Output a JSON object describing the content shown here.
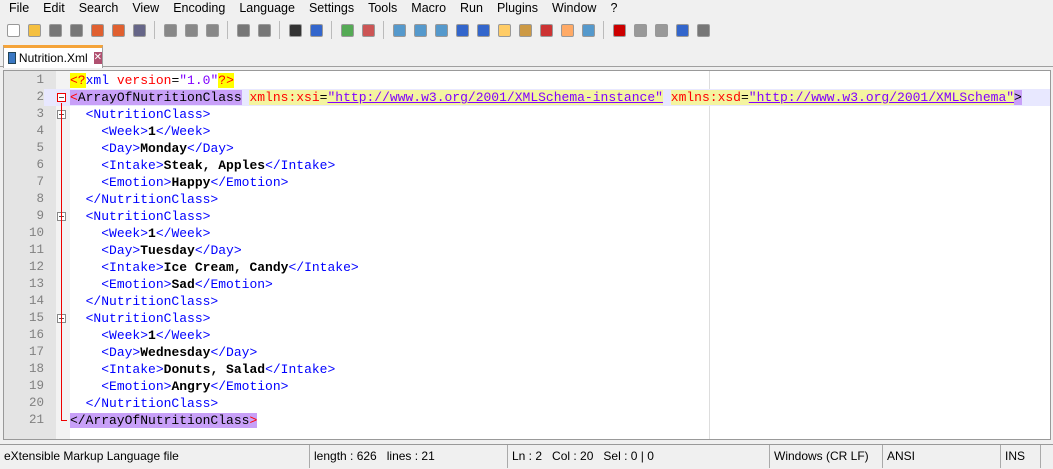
{
  "menu": [
    "File",
    "Edit",
    "Search",
    "View",
    "Encoding",
    "Language",
    "Settings",
    "Tools",
    "Macro",
    "Run",
    "Plugins",
    "Window",
    "?"
  ],
  "toolbar": [
    "new",
    "open",
    "save",
    "save-all",
    "close",
    "close-all",
    "print",
    "|",
    "cut",
    "copy",
    "paste",
    "|",
    "undo",
    "redo",
    "|",
    "find",
    "replace",
    "|",
    "zoom-in",
    "zoom-out",
    "|",
    "sync-v",
    "sync-h",
    "wrap",
    "all-chars",
    "indent-guide",
    "udl",
    "doc-map",
    "function-list",
    "folder",
    "monitor",
    "|",
    "record",
    "stop",
    "play",
    "play-multiple",
    "save-macro"
  ],
  "tab": {
    "label": "Nutrition.Xml",
    "close": "✕"
  },
  "current_line": 2,
  "lines": [
    [
      [
        "pi",
        "<?"
      ],
      [
        "piname",
        "xml "
      ],
      [
        "attr",
        "version"
      ],
      [
        "eq",
        "="
      ],
      [
        "val",
        "\"1.0\""
      ],
      [
        "pi",
        "?>"
      ]
    ],
    [
      [
        "hlbr",
        "<"
      ],
      [
        "hl",
        "ArrayOfNutritionClass"
      ],
      [
        "txt",
        " "
      ],
      [
        "hlattr",
        "xmlns:xsi"
      ],
      [
        "hleq",
        "="
      ],
      [
        "hlval",
        "\"http://www.w3.org/2001/XMLSchema-instance\""
      ],
      [
        "txt",
        " "
      ],
      [
        "hlattr",
        "xmlns:xsd"
      ],
      [
        "hleq",
        "="
      ],
      [
        "hlval",
        "\"http://www.w3.org/2001/XMLSchema\""
      ],
      [
        "hl",
        ">"
      ]
    ],
    [
      [
        "txt",
        "  "
      ],
      [
        "tag",
        "<NutritionClass>"
      ]
    ],
    [
      [
        "txt",
        "    "
      ],
      [
        "tag",
        "<Week>"
      ],
      [
        "txt",
        "1"
      ],
      [
        "tag",
        "</Week>"
      ]
    ],
    [
      [
        "txt",
        "    "
      ],
      [
        "tag",
        "<Day>"
      ],
      [
        "txt",
        "Monday"
      ],
      [
        "tag",
        "</Day>"
      ]
    ],
    [
      [
        "txt",
        "    "
      ],
      [
        "tag",
        "<Intake>"
      ],
      [
        "txt",
        "Steak, Apples"
      ],
      [
        "tag",
        "</Intake>"
      ]
    ],
    [
      [
        "txt",
        "    "
      ],
      [
        "tag",
        "<Emotion>"
      ],
      [
        "txt",
        "Happy"
      ],
      [
        "tag",
        "</Emotion>"
      ]
    ],
    [
      [
        "txt",
        "  "
      ],
      [
        "tag",
        "</NutritionClass>"
      ]
    ],
    [
      [
        "txt",
        "  "
      ],
      [
        "tag",
        "<NutritionClass>"
      ]
    ],
    [
      [
        "txt",
        "    "
      ],
      [
        "tag",
        "<Week>"
      ],
      [
        "txt",
        "1"
      ],
      [
        "tag",
        "</Week>"
      ]
    ],
    [
      [
        "txt",
        "    "
      ],
      [
        "tag",
        "<Day>"
      ],
      [
        "txt",
        "Tuesday"
      ],
      [
        "tag",
        "</Day>"
      ]
    ],
    [
      [
        "txt",
        "    "
      ],
      [
        "tag",
        "<Intake>"
      ],
      [
        "txt",
        "Ice Cream, Candy"
      ],
      [
        "tag",
        "</Intake>"
      ]
    ],
    [
      [
        "txt",
        "    "
      ],
      [
        "tag",
        "<Emotion>"
      ],
      [
        "txt",
        "Sad"
      ],
      [
        "tag",
        "</Emotion>"
      ]
    ],
    [
      [
        "txt",
        "  "
      ],
      [
        "tag",
        "</NutritionClass>"
      ]
    ],
    [
      [
        "txt",
        "  "
      ],
      [
        "tag",
        "<NutritionClass>"
      ]
    ],
    [
      [
        "txt",
        "    "
      ],
      [
        "tag",
        "<Week>"
      ],
      [
        "txt",
        "1"
      ],
      [
        "tag",
        "</Week>"
      ]
    ],
    [
      [
        "txt",
        "    "
      ],
      [
        "tag",
        "<Day>"
      ],
      [
        "txt",
        "Wednesday"
      ],
      [
        "tag",
        "</Day>"
      ]
    ],
    [
      [
        "txt",
        "    "
      ],
      [
        "tag",
        "<Intake>"
      ],
      [
        "txt",
        "Donuts, Salad"
      ],
      [
        "tag",
        "</Intake>"
      ]
    ],
    [
      [
        "txt",
        "    "
      ],
      [
        "tag",
        "<Emotion>"
      ],
      [
        "txt",
        "Angry"
      ],
      [
        "tag",
        "</Emotion>"
      ]
    ],
    [
      [
        "txt",
        "  "
      ],
      [
        "tag",
        "</NutritionClass>"
      ]
    ],
    [
      [
        "hl",
        "</ArrayOfNutritionClass"
      ],
      [
        "hlbr",
        ">"
      ]
    ]
  ],
  "folds": [
    2,
    3,
    9,
    15
  ],
  "status": {
    "language": "eXtensible Markup Language file",
    "length": "length : 626",
    "lines": "lines : 21",
    "ln": "Ln : 2",
    "col": "Col : 20",
    "sel": "Sel : 0 | 0",
    "eol": "Windows (CR LF)",
    "encoding": "ANSI",
    "mode": "INS"
  }
}
